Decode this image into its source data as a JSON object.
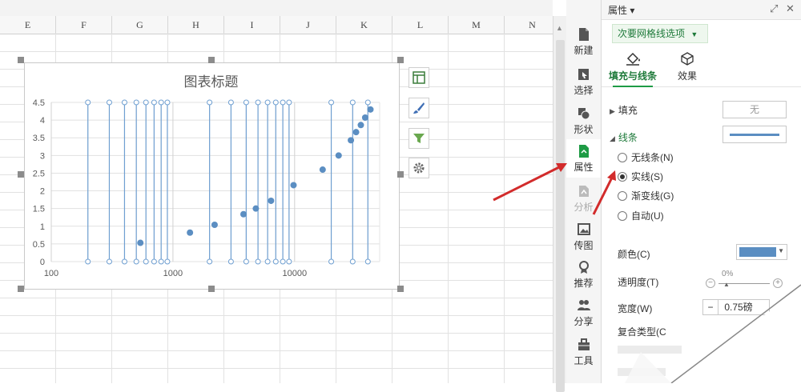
{
  "sheet": {
    "columns": [
      "E",
      "F",
      "G",
      "H",
      "I",
      "J",
      "K",
      "L",
      "M",
      "N"
    ]
  },
  "chart": {
    "title": "图表标题"
  },
  "chart_data": {
    "type": "scatter",
    "title": "图表标题",
    "x_scale": "log",
    "xlim": [
      100,
      50000
    ],
    "ylim": [
      0,
      4.5
    ],
    "x_tick_labels": [
      "100",
      "1000",
      "10000"
    ],
    "y_tick_labels": [
      "0",
      "0.5",
      "1",
      "1.5",
      "2",
      "2.5",
      "3",
      "3.5",
      "4",
      "4.5"
    ],
    "minor_gridlines": "vertical, solid",
    "series": [
      {
        "x": [
          540,
          1380,
          2200,
          3800,
          4800,
          6400,
          9800,
          17000,
          23000,
          29000,
          32000,
          35000,
          38000,
          42000
        ],
        "y": [
          0.53,
          0.82,
          1.04,
          1.34,
          1.5,
          1.72,
          2.16,
          2.6,
          3.0,
          3.43,
          3.66,
          3.86,
          4.07,
          4.3
        ],
        "color": "#5b8ec2"
      }
    ]
  },
  "toolbar": {
    "items": [
      {
        "label": "新建"
      },
      {
        "label": "选择"
      },
      {
        "label": "形状"
      },
      {
        "label": "属性"
      },
      {
        "label": "分析"
      },
      {
        "label": "传图"
      },
      {
        "label": "推荐"
      },
      {
        "label": "分享"
      },
      {
        "label": "工具"
      }
    ]
  },
  "panel": {
    "title": "属性",
    "dropdown": "次要网格线选项",
    "tab_fill": "填充与线条",
    "tab_effect": "效果",
    "fill_label": "填充",
    "fill_value": "无",
    "line_label": "线条",
    "radios": [
      "无线条(N)",
      "实线(S)",
      "渐变线(G)",
      "自动(U)"
    ],
    "color_label": "颜色(C)",
    "transparency_label": "透明度(T)",
    "transparency_value": "0%",
    "width_label": "宽度(W)",
    "width_value": "0.75磅",
    "compound_label": "复合类型(C",
    "line_color": "#5b8ec2"
  },
  "colors": {
    "accent_green": "#1e9b45",
    "marker_blue": "#5b8ec2",
    "arrow_red": "#d22b2b"
  },
  "icons": [
    "new-icon",
    "select-icon",
    "shape-icon",
    "properties-icon",
    "analysis-icon",
    "upload-image-icon",
    "recommend-icon",
    "share-icon",
    "tools-icon",
    "chart-elements-icon",
    "chart-style-icon",
    "chart-filter-icon",
    "gear-icon"
  ]
}
